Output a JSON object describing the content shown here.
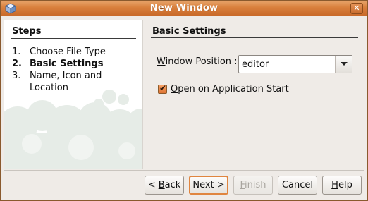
{
  "window": {
    "title": "New Window"
  },
  "steps": {
    "heading": "Steps",
    "items": [
      {
        "number": "1.",
        "label": "Choose File Type",
        "current": false
      },
      {
        "number": "2.",
        "label": "Basic Settings",
        "current": true
      },
      {
        "number": "3.",
        "label": "Name, Icon and Location",
        "current": false
      }
    ]
  },
  "content": {
    "heading": "Basic Settings",
    "window_position": {
      "label_mnemonic": "W",
      "label_rest": "indow Position :",
      "value": "editor"
    },
    "open_on_start": {
      "checked": true,
      "label_mnemonic": "O",
      "label_rest": "pen on Application Start"
    }
  },
  "buttons": {
    "back": {
      "prefix": "< ",
      "mnemonic": "B",
      "rest": "ack"
    },
    "next": {
      "label": "Next >"
    },
    "finish": {
      "mnemonic": "F",
      "rest": "inish",
      "enabled": false
    },
    "cancel": {
      "label": "Cancel"
    },
    "help": {
      "mnemonic": "H",
      "rest": "elp"
    }
  },
  "colors": {
    "titlebar": "#d9803d",
    "accent": "#e0853f",
    "dialog_bg": "#efebe7"
  }
}
